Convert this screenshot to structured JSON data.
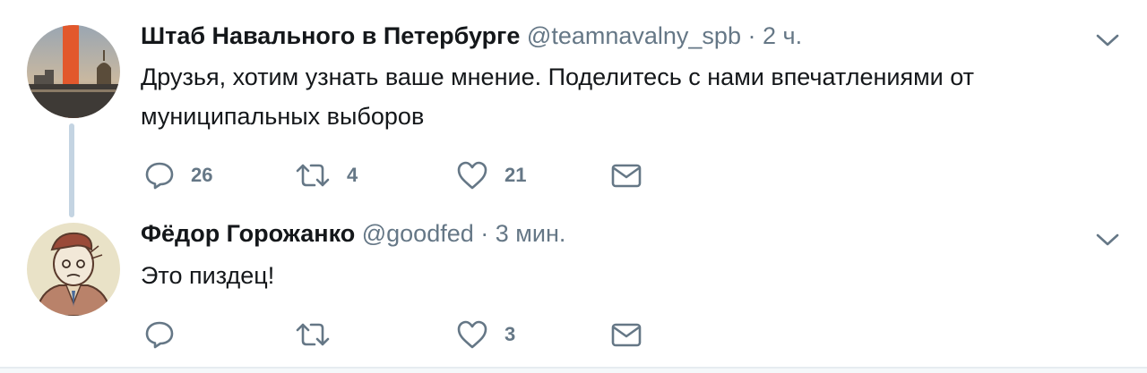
{
  "tweets": [
    {
      "author_name": "Штаб Навального в Петербурге",
      "handle": "@teamnavalny_spb",
      "separator": "·",
      "time": "2 ч.",
      "text": "Друзья, хотим узнать ваше мнение. Поделитесь с нами впечатлениями от муниципальных выборов",
      "reply_count": "26",
      "retweet_count": "4",
      "like_count": "21"
    },
    {
      "author_name": "Фёдор Горожанко",
      "handle": "@goodfed",
      "separator": "·",
      "time": "3 мин.",
      "text": "Это пиздец!",
      "reply_count": "",
      "retweet_count": "",
      "like_count": "3"
    }
  ],
  "icons": {
    "reply": "reply-icon",
    "retweet": "retweet-icon",
    "like": "heart-icon",
    "dm": "envelope-icon",
    "menu": "chevron-down-icon"
  },
  "colors": {
    "icon_gray": "#657786",
    "text": "#14171a",
    "thread_line": "#c4d4e2"
  }
}
